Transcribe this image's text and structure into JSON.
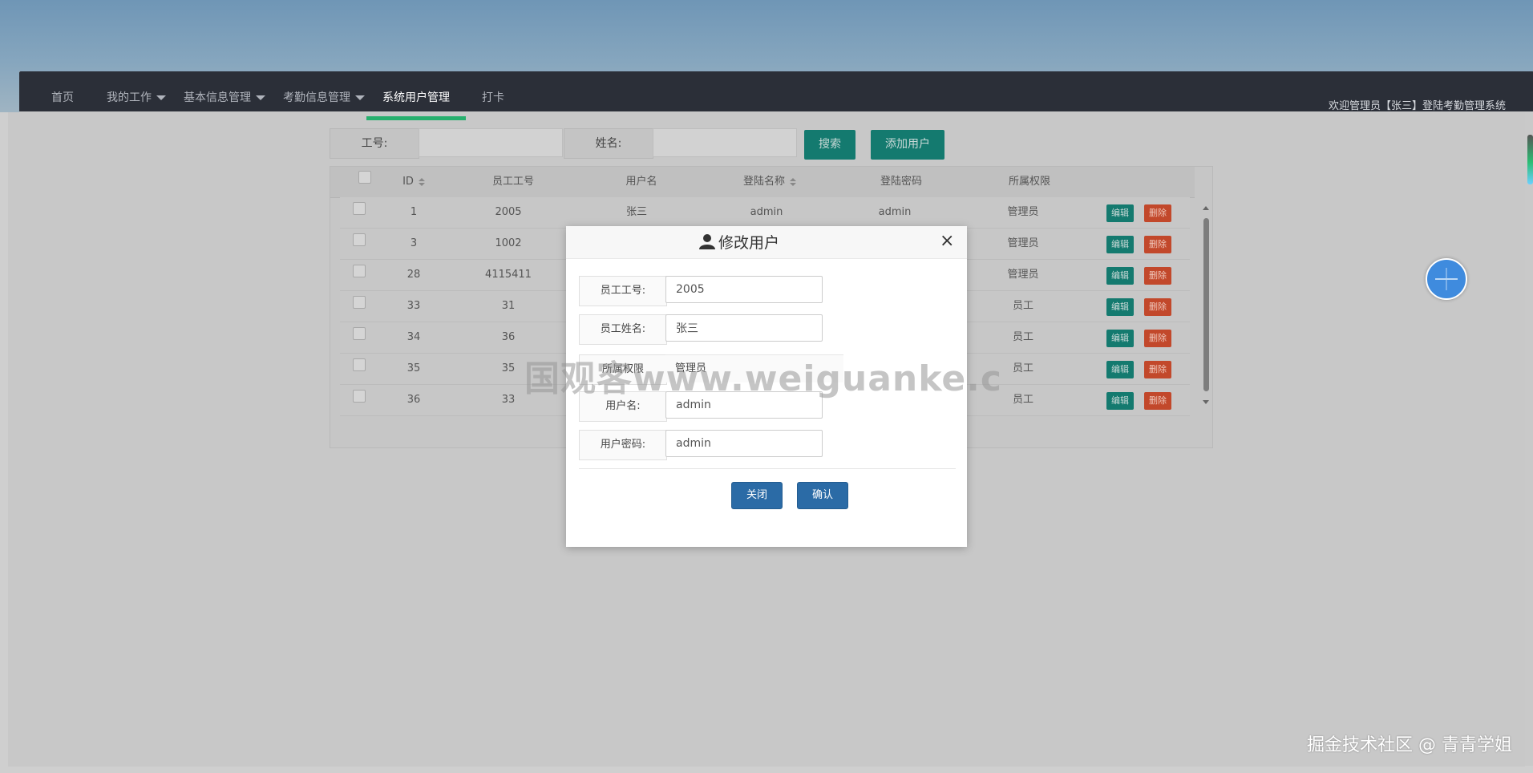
{
  "nav": {
    "items": [
      {
        "label": "首页",
        "dropdown": false
      },
      {
        "label": "我的工作",
        "dropdown": true
      },
      {
        "label": "基本信息管理",
        "dropdown": true
      },
      {
        "label": "考勤信息管理",
        "dropdown": true
      },
      {
        "label": "系统用户管理",
        "dropdown": false,
        "active": true
      },
      {
        "label": "打卡",
        "dropdown": false
      }
    ],
    "welcome": "欢迎管理员【张三】登陆考勤管理系统"
  },
  "search": {
    "emp_no_label": "工号:",
    "emp_no_value": "",
    "name_label": "姓名:",
    "name_value": "",
    "search_button": "搜索",
    "add_button": "添加用户"
  },
  "table": {
    "headers": [
      "ID",
      "员工工号",
      "用户名",
      "登陆名称",
      "登陆密码",
      "所属权限"
    ],
    "rows": [
      {
        "id": "1",
        "emp_no": "2005",
        "username": "张三",
        "login": "admin",
        "password": "admin",
        "role": "管理员"
      },
      {
        "id": "3",
        "emp_no": "1002",
        "username": "",
        "login": "",
        "password": "",
        "role": "管理员"
      },
      {
        "id": "28",
        "emp_no": "4115411",
        "username": "",
        "login": "",
        "password": "",
        "role": "管理员"
      },
      {
        "id": "33",
        "emp_no": "31",
        "username": "",
        "login": "",
        "password": "",
        "role": "员工"
      },
      {
        "id": "34",
        "emp_no": "36",
        "username": "",
        "login": "",
        "password": "",
        "role": "员工"
      },
      {
        "id": "35",
        "emp_no": "35",
        "username": "",
        "login": "",
        "password": "",
        "role": "员工"
      },
      {
        "id": "36",
        "emp_no": "33",
        "username": "",
        "login": "",
        "password": "",
        "role": "员工"
      }
    ],
    "edit_label": "编辑",
    "delete_label": "删除"
  },
  "modal": {
    "title": "修改用户",
    "close_symbol": "×",
    "fields": {
      "emp_no_label": "员工工号:",
      "emp_no_value": "2005",
      "emp_name_label": "员工姓名:",
      "emp_name_value": "张三",
      "role_label": "所属权限",
      "role_value": "管理员",
      "username_label": "用户名:",
      "username_value": "admin",
      "password_label": "用户密码:",
      "password_value": "admin"
    },
    "close_button": "关闭",
    "confirm_button": "确认"
  },
  "watermark": "国观客www.weiguanke.c",
  "corner_text": "掘金技术社区 @ 青青学姐",
  "icons": {
    "modal_title_icon": "user-icon",
    "dropdown_icon": "caret-down-icon",
    "sort_icon": "sort-icon"
  },
  "colors": {
    "nav_bg": "#2b2f38",
    "active_underline": "#27b06e",
    "primary_green": "#147a6f",
    "danger": "#c2482b",
    "modal_button": "#2b6ba6"
  }
}
